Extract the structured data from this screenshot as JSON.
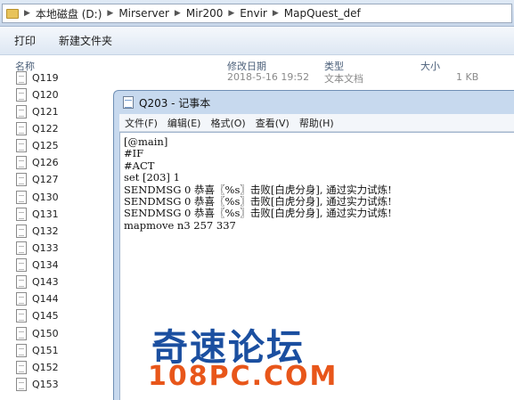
{
  "address_bar": {
    "crumbs": [
      "本地磁盘 (D:)",
      "Mirserver",
      "Mir200",
      "Envir",
      "MapQuest_def"
    ]
  },
  "toolbar": {
    "print_label": "打印",
    "new_folder_label": "新建文件夹"
  },
  "columns": {
    "name": "名称",
    "modified": "修改日期",
    "type": "类型",
    "size": "大小"
  },
  "files": {
    "first_row": {
      "name": "Q119",
      "modified": "2018-5-16 19:52",
      "type": "文本文档",
      "size": "1 KB"
    },
    "names": [
      "Q120",
      "Q121",
      "Q122",
      "Q125",
      "Q126",
      "Q127",
      "Q130",
      "Q131",
      "Q132",
      "Q133",
      "Q134",
      "Q143",
      "Q144",
      "Q145",
      "Q150",
      "Q151",
      "Q152",
      "Q153"
    ]
  },
  "notepad": {
    "title": "Q203 - 记事本",
    "menus": [
      "文件(F)",
      "编辑(E)",
      "格式(O)",
      "查看(V)",
      "帮助(H)"
    ],
    "lines": [
      "[@main]",
      "#IF",
      "#ACT",
      "set [203] 1",
      "SENDMSG 0 恭喜〖%s〗击败[白虎分身], 通过实力试炼!",
      "SENDMSG 0 恭喜〖%s〗击败[白虎分身], 通过实力试炼!",
      "SENDMSG 0 恭喜〖%s〗击败[白虎分身], 通过实力试炼!",
      "mapmove n3 257 337"
    ]
  },
  "watermark": {
    "main": "奇速论坛",
    "sub": "108PC.COM"
  },
  "colors": {
    "watermark_blue": "#1b4fa0",
    "watermark_orange": "#e8561a",
    "window_frame": "#c7d9ee"
  }
}
